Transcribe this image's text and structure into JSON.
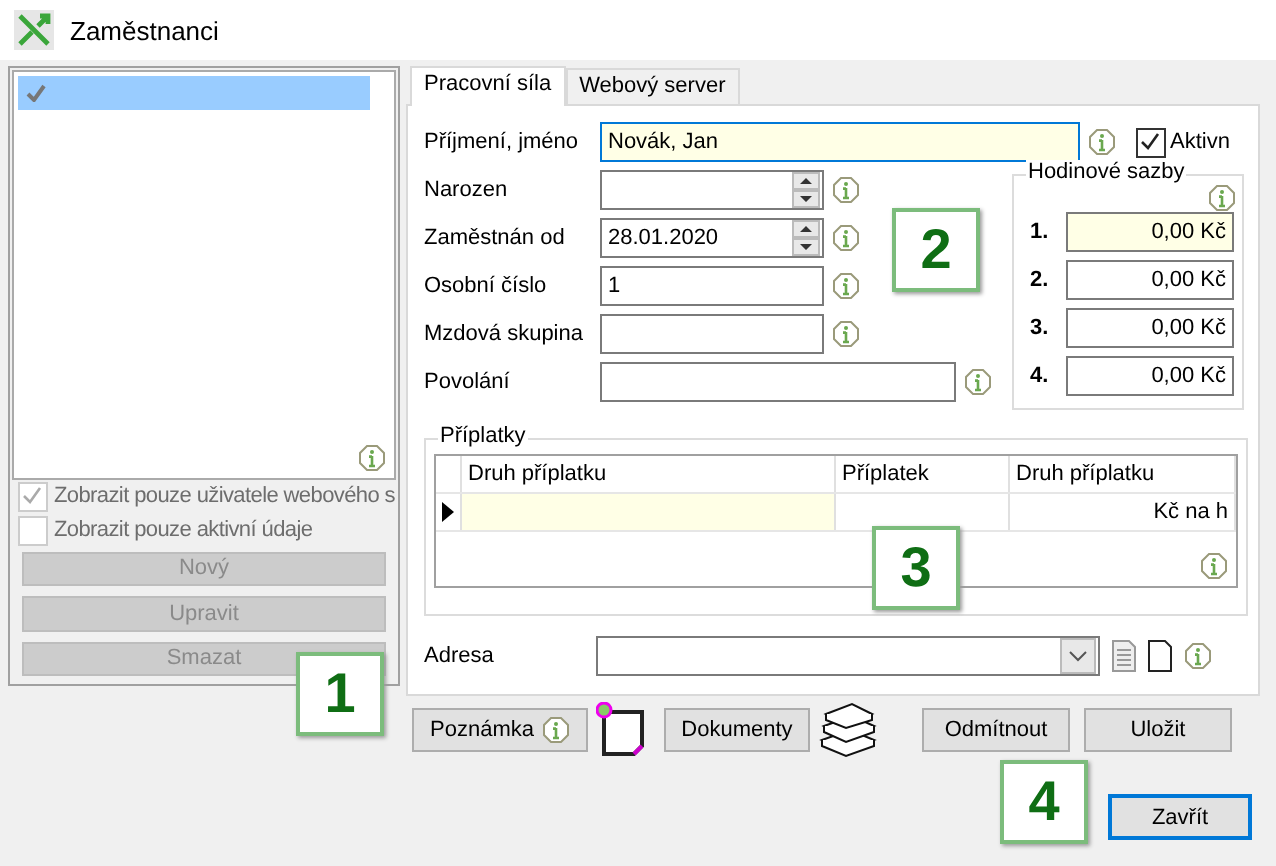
{
  "window": {
    "title": "Zaměstnanci"
  },
  "employee_list": {
    "items": [
      {
        "checked": true,
        "selected": true
      }
    ]
  },
  "filters": [
    {
      "label": "Zobrazit pouze uživatele webového s",
      "checked": true,
      "disabled": true
    },
    {
      "label": "Zobrazit pouze aktivní údaje",
      "checked": false,
      "disabled": true
    }
  ],
  "list_buttons": [
    {
      "label": "Nový",
      "disabled": true
    },
    {
      "label": "Upravit",
      "disabled": true
    },
    {
      "label": "Smazat",
      "disabled": true
    }
  ],
  "tabs": [
    {
      "label": "Pracovní síla",
      "selected": true
    },
    {
      "label": "Webový server",
      "selected": false
    }
  ],
  "name": {
    "label": "Příjmení, jméno",
    "value": "Novák, Jan",
    "focused": true
  },
  "active": {
    "label": "Aktivn",
    "checked": true
  },
  "fields": [
    {
      "label": "Narozen",
      "kind": "date"
    },
    {
      "label": "Zaměstnán od",
      "kind": "date",
      "value": "28.01.2020"
    },
    {
      "label": "Osobní číslo",
      "kind": "text",
      "value": "1"
    },
    {
      "label": "Mzdová skupina",
      "kind": "text"
    },
    {
      "label": "Povolání",
      "kind": "wide"
    }
  ],
  "hourly_rates": {
    "title": "Hodinové sazby",
    "rates": [
      {
        "index": "1.",
        "value": "0,00 Kč",
        "selected": true
      },
      {
        "index": "2.",
        "value": "0,00 Kč",
        "selected": false
      },
      {
        "index": "3.",
        "value": "0,00 Kč",
        "selected": false
      },
      {
        "index": "4.",
        "value": "0,00 Kč",
        "selected": false
      }
    ]
  },
  "surcharges": {
    "title": "Příplatky",
    "columns": [
      "Druh příplatku",
      "Příplatek",
      "Druh příplatku"
    ],
    "rows": [
      {
        "current": true,
        "column_3": "Kč na h"
      }
    ]
  },
  "address": {
    "label": "Adresa"
  },
  "buttons": [
    {
      "label": "Poznámka",
      "kind": "note"
    },
    {
      "label": "Dokumenty",
      "kind": "documents"
    },
    {
      "label": "Odmítnout",
      "kind": "plain"
    },
    {
      "label": "Uložit",
      "kind": "plain"
    }
  ],
  "close_button": {
    "label": "Zavřít",
    "focused": true
  },
  "callouts": [
    "1",
    "2",
    "3",
    "4"
  ]
}
